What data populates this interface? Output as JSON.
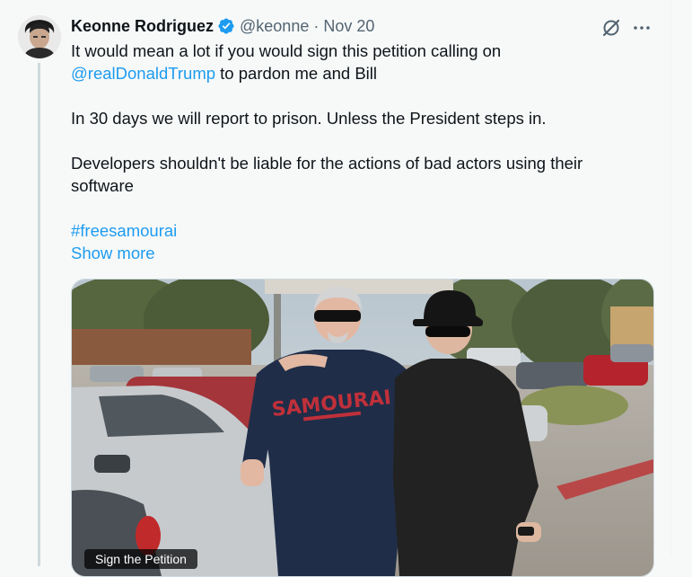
{
  "tweet": {
    "author": {
      "display_name": "Keonne Rodriguez",
      "handle": "@keonne",
      "verified": true
    },
    "date": "Nov 20",
    "separator": "·",
    "text": {
      "line1": "It would mean a lot if you would sign this petition calling on",
      "mention": "@realDonaldTrump",
      "line2_rest": " to pardon me and Bill",
      "para2": "In 30 days we will report to prison. Unless the President steps in.",
      "para3": "Developers shouldn't be liable for the actions of bad actors using their software",
      "hashtag": "#freesamourai",
      "show_more": "Show more"
    },
    "media": {
      "card_label": "Sign the Petition",
      "shirt_text": "SAMOURAI"
    },
    "icons": {
      "grok": "grok-icon",
      "more": "more-icon",
      "verified": "verified-badge-icon"
    }
  },
  "colors": {
    "accent": "#1d9bf0",
    "text": "#0f1419",
    "muted": "#536471",
    "background": "#f7f9f9"
  }
}
